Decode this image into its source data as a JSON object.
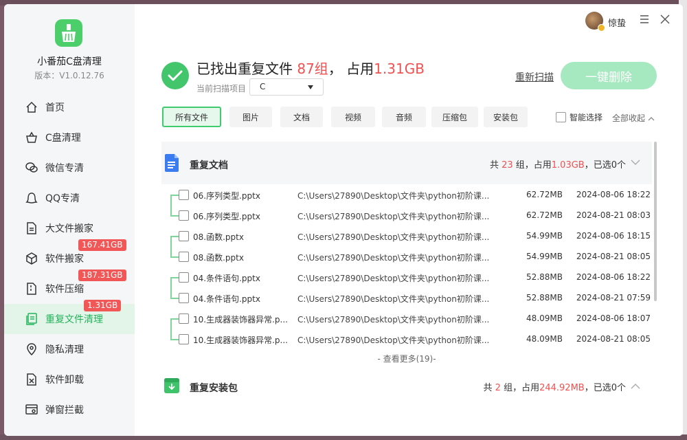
{
  "app": {
    "name": "小番茄C盘清理",
    "version": "版本：V1.0.12.76"
  },
  "user": {
    "name": "惊蛰"
  },
  "sidebar": {
    "items": [
      {
        "label": "首页",
        "icon": "home-icon",
        "badge": ""
      },
      {
        "label": "C盘清理",
        "icon": "basket-icon",
        "badge": ""
      },
      {
        "label": "微信专清",
        "icon": "wechat-icon",
        "badge": ""
      },
      {
        "label": "QQ专清",
        "icon": "qq-icon",
        "badge": ""
      },
      {
        "label": "大文件搬家",
        "icon": "big-file-icon",
        "badge": ""
      },
      {
        "label": "软件搬家",
        "icon": "box-icon",
        "badge": "167.41GB"
      },
      {
        "label": "软件压缩",
        "icon": "compress-icon",
        "badge": "187.31GB"
      },
      {
        "label": "重复文件清理",
        "icon": "duplicate-icon",
        "badge": "1.31GB"
      },
      {
        "label": "隐私清理",
        "icon": "privacy-icon",
        "badge": ""
      },
      {
        "label": "软件卸载",
        "icon": "uninstall-icon",
        "badge": ""
      },
      {
        "label": "弹窗拦截",
        "icon": "popup-block-icon",
        "badge": ""
      }
    ],
    "active_index": 7
  },
  "header": {
    "prefix": "已找出重复文件 ",
    "count": "87组",
    "mid": "，  占用",
    "size": "1.31GB",
    "scan_label": "当前扫描项目",
    "drive": "C",
    "rescan": "重新扫描",
    "delete_button": "一键删除"
  },
  "filters": [
    "所有文件",
    "图片",
    "文档",
    "视频",
    "音频",
    "压缩包",
    "安装包"
  ],
  "active_filter": 0,
  "smart_select": "智能选择",
  "collapse_all": "全部收起",
  "groups": [
    {
      "title": "重复文档",
      "sum_prefix": "共 ",
      "sum_count": "23",
      "sum_mid": " 组，占用",
      "sum_size": "1.03GB",
      "sum_suffix": "，已选0个",
      "files": [
        {
          "name": "06.序列类型.pptx",
          "path": "C:\\Users\\27890\\Desktop\\文件夹\\python初阶课...",
          "size": "62.72MB",
          "date": "2024-08-06 18:22"
        },
        {
          "name": "06.序列类型.pptx",
          "path": "C:\\Users\\27890\\Desktop\\文件夹\\python初阶课...",
          "size": "62.72MB",
          "date": "2024-08-21 08:03"
        },
        {
          "name": "08.函数.pptx",
          "path": "C:\\Users\\27890\\Desktop\\文件夹\\python初阶课...",
          "size": "54.99MB",
          "date": "2024-08-06 18:15"
        },
        {
          "name": "08.函数.pptx",
          "path": "C:\\Users\\27890\\Desktop\\文件夹\\python初阶课...",
          "size": "54.99MB",
          "date": "2024-08-21 08:05"
        },
        {
          "name": "04.条件语句.pptx",
          "path": "C:\\Users\\27890\\Desktop\\文件夹\\python初阶课...",
          "size": "52.88MB",
          "date": "2024-08-06 18:22"
        },
        {
          "name": "04.条件语句.pptx",
          "path": "C:\\Users\\27890\\Desktop\\文件夹\\python初阶课...",
          "size": "52.88MB",
          "date": "2024-08-21 07:59"
        },
        {
          "name": "10.生成器装饰器异常.p...",
          "path": "C:\\Users\\27890\\Desktop\\文件夹\\python初阶课...",
          "size": "48.09MB",
          "date": "2024-08-06 18:07"
        },
        {
          "name": "10.生成器装饰器异常.p...",
          "path": "C:\\Users\\27890\\Desktop\\文件夹\\python初阶课...",
          "size": "48.09MB",
          "date": "2024-08-21 08:05"
        }
      ],
      "see_more": "- 查看更多(19)-"
    },
    {
      "title": "重复安装包",
      "sum_prefix": "共 ",
      "sum_count": "2",
      "sum_mid": " 组，占用",
      "sum_size": "244.92MB",
      "sum_suffix": "，已选0个"
    }
  ],
  "colors": {
    "accent": "#3ecb6e",
    "highlight": "#f05050",
    "badge": "#f25757"
  }
}
